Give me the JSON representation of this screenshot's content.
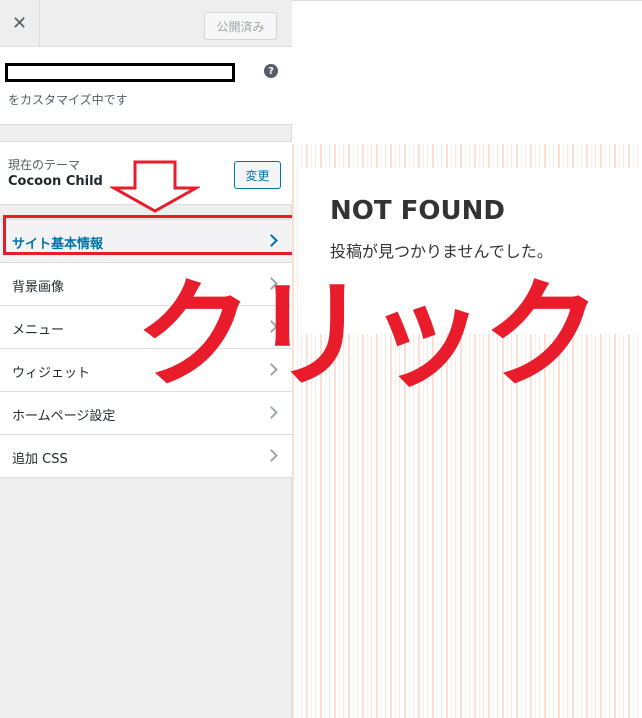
{
  "topbar": {
    "close_icon": "close-icon",
    "close_glyph": "✕",
    "publish_label": "公開済み"
  },
  "info": {
    "caption": "をカスタマイズ中です",
    "help_icon": "help-icon",
    "help_glyph": "?"
  },
  "theme": {
    "caption": "現在のテーマ",
    "name": "Cocoon Child",
    "change_label": "変更"
  },
  "menu": {
    "items": [
      {
        "label": "サイト基本情報",
        "active": true
      },
      {
        "label": "背景画像"
      },
      {
        "label": "メニュー"
      },
      {
        "label": "ウィジェット"
      },
      {
        "label": "ホームページ設定"
      },
      {
        "label": "追加 CSS"
      }
    ]
  },
  "preview": {
    "title": "NOT FOUND",
    "message": "投稿が見つかりませんでした。"
  },
  "annotation": {
    "click_text": "クリック",
    "arrow_icon": "down-arrow-icon",
    "color": "#e81c2a"
  },
  "colors": {
    "accent": "#0073aa",
    "sidebar_bg": "#eeeeee",
    "highlight": "#e81c2a"
  }
}
